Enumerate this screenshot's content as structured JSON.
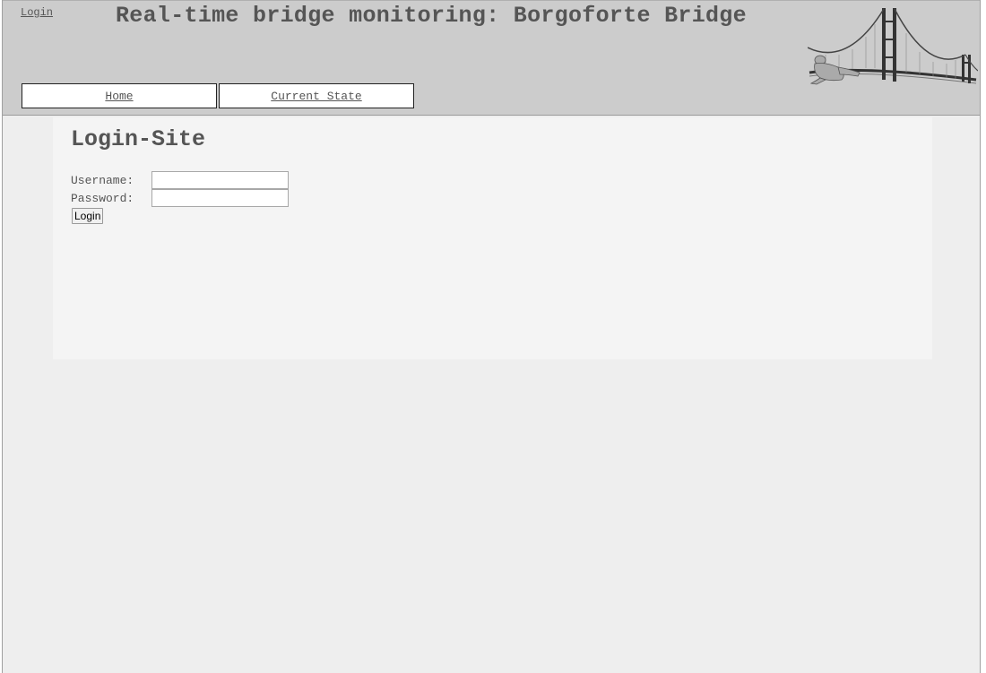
{
  "header": {
    "login_link": "Login",
    "title": "Real-time bridge monitoring: Borgoforte Bridge",
    "logo_icon": "bridge-logo-icon"
  },
  "nav": {
    "items": [
      {
        "label": "Home"
      },
      {
        "label": "Current State"
      }
    ]
  },
  "main": {
    "heading": "Login-Site",
    "username_label": "Username:",
    "username_value": "",
    "password_label": "Password:",
    "password_value": "",
    "login_button": "Login"
  },
  "colors": {
    "header_bg": "#cccccc",
    "page_bg": "#eeeeee",
    "content_bg": "#f4f4f4",
    "text": "#555555"
  }
}
